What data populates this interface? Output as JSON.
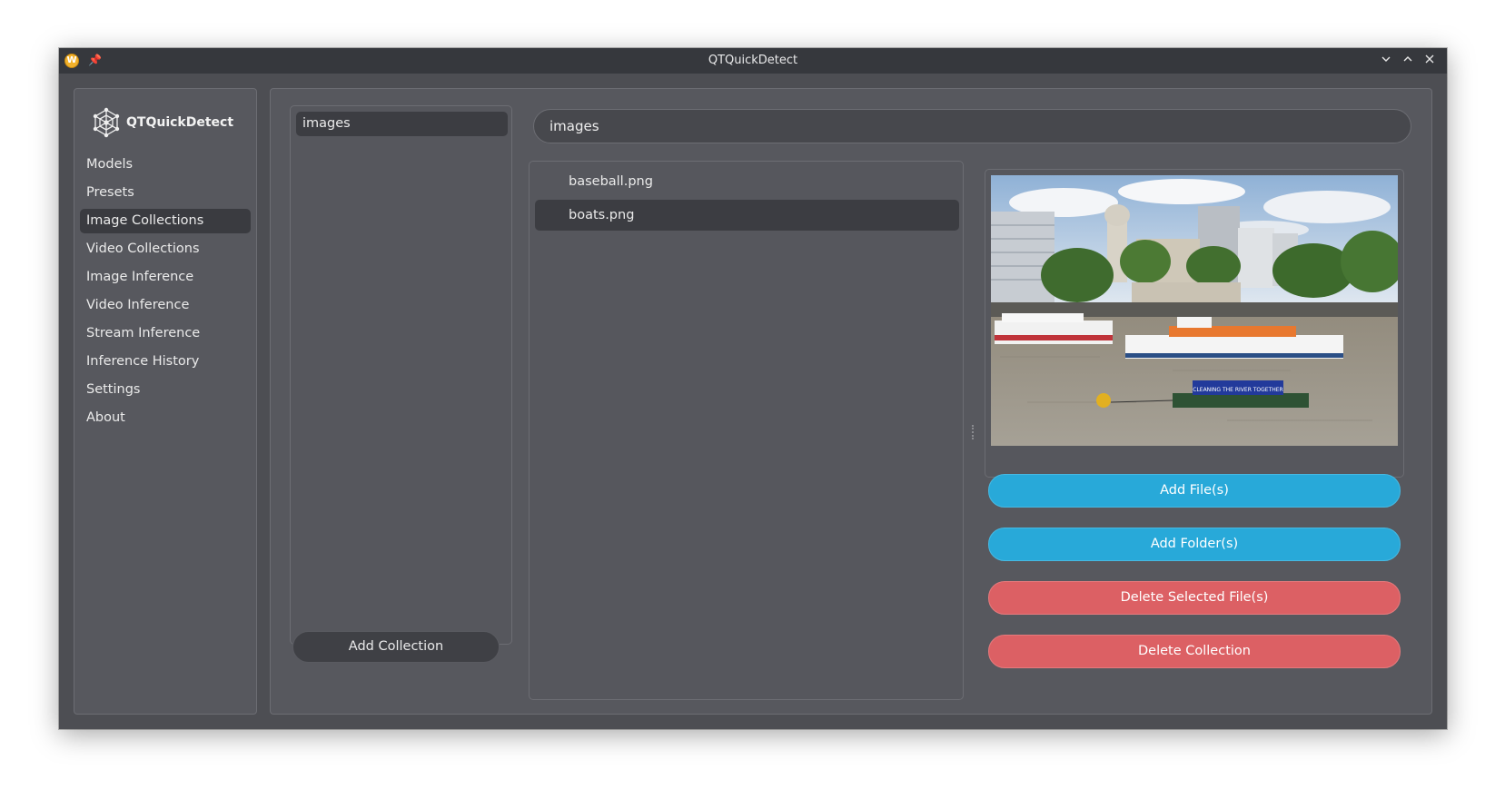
{
  "window": {
    "title": "QTQuickDetect",
    "app_icon_letter": "W",
    "controls": {
      "minimize_icon": "chevron-down-icon",
      "maximize_icon": "chevron-up-icon",
      "close_icon": "close-icon"
    }
  },
  "sidebar": {
    "app_name": "QTQuickDetect",
    "items": [
      {
        "label": "Models",
        "active": false
      },
      {
        "label": "Presets",
        "active": false
      },
      {
        "label": "Image Collections",
        "active": true
      },
      {
        "label": "Video Collections",
        "active": false
      },
      {
        "label": "Image Inference",
        "active": false
      },
      {
        "label": "Video Inference",
        "active": false
      },
      {
        "label": "Stream Inference",
        "active": false
      },
      {
        "label": "Inference History",
        "active": false
      },
      {
        "label": "Settings",
        "active": false
      },
      {
        "label": "About",
        "active": false
      }
    ]
  },
  "collections": {
    "items": [
      "images"
    ],
    "selected": "images",
    "add_button": "Add Collection"
  },
  "editor": {
    "collection_name": "images",
    "files": [
      {
        "name": "baseball.png",
        "selected": false
      },
      {
        "name": "boats.png",
        "selected": true
      }
    ],
    "preview_subject": "boats on river with city skyline",
    "boat_banner_text": "CLEANING THE RIVER TOGETHER",
    "actions": {
      "add_files": "Add File(s)",
      "add_folders": "Add Folder(s)",
      "delete_files": "Delete Selected File(s)",
      "delete_collection": "Delete Collection"
    }
  },
  "colors": {
    "accent_blue": "#28a9d9",
    "danger_red": "#dc6064",
    "background": "#4d4e53",
    "selection": "#3c3d42"
  }
}
